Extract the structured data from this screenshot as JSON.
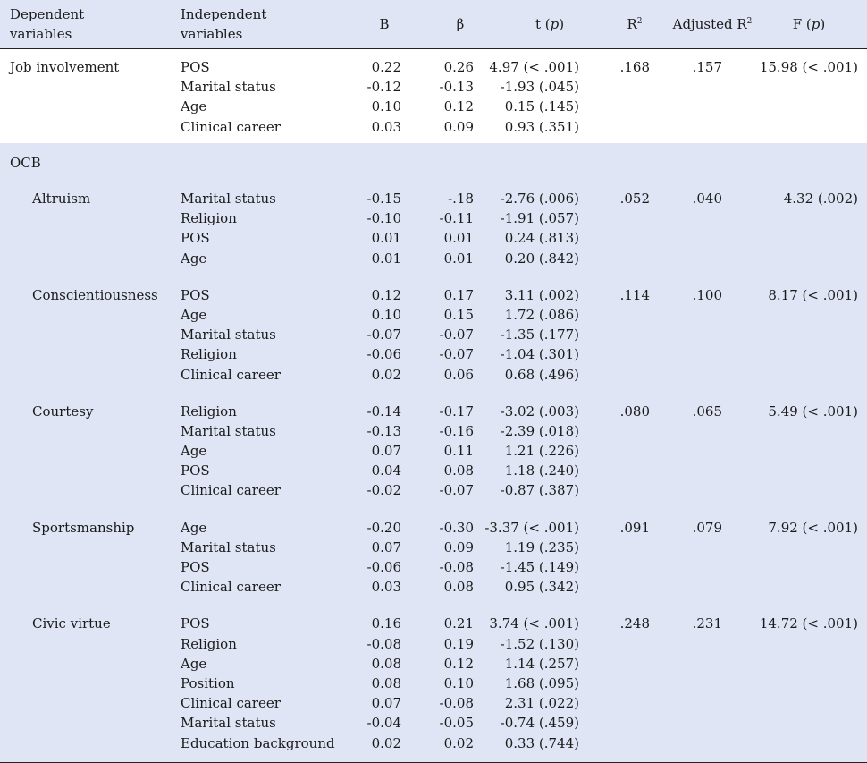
{
  "headers": {
    "dependent": [
      "Dependent",
      "variables"
    ],
    "independent": [
      "Independent",
      "variables"
    ],
    "b": "B",
    "beta": "β",
    "t": "t (",
    "t_p": "p",
    "r2": "R",
    "r2_sup": "2",
    "adj_r2": "Adjusted R",
    "adj_r2_sup": "2",
    "f": "F (",
    "f_p": "p",
    "close_paren": ")"
  },
  "job": {
    "label": "Job involvement",
    "r2": ".168",
    "adj_r2": ".157",
    "f": "15.98 (< .001)",
    "rows": [
      {
        "var": "POS",
        "b": "0.22",
        "beta": "0.26",
        "t": "4.97 (< .001)"
      },
      {
        "var": "Marital status",
        "b": "-0.12",
        "beta": "-0.13",
        "t": "-1.93 (.045)"
      },
      {
        "var": "Age",
        "b": "0.10",
        "beta": "0.12",
        "t": "0.15 (.145)"
      },
      {
        "var": "Clinical career",
        "b": "0.03",
        "beta": "0.09",
        "t": "0.93 (.351)"
      }
    ]
  },
  "ocb": {
    "label": "OCB",
    "altruism": {
      "label": "Altruism",
      "r2": ".052",
      "adj_r2": ".040",
      "f": "4.32 (.002)",
      "rows": [
        {
          "var": "Marital status",
          "b": "-0.15",
          "beta": "-.18",
          "t": "-2.76 (.006)"
        },
        {
          "var": "Religion",
          "b": "-0.10",
          "beta": "-0.11",
          "t": "-1.91 (.057)"
        },
        {
          "var": "POS",
          "b": "0.01",
          "beta": "0.01",
          "t": "0.24 (.813)"
        },
        {
          "var": "Age",
          "b": "0.01",
          "beta": "0.01",
          "t": "0.20 (.842)"
        }
      ]
    },
    "conscientiousness": {
      "label": "Conscientiousness",
      "r2": ".114",
      "adj_r2": ".100",
      "f": "8.17 (< .001)",
      "rows": [
        {
          "var": "POS",
          "b": "0.12",
          "beta": "0.17",
          "t": "3.11 (.002)"
        },
        {
          "var": "Age",
          "b": "0.10",
          "beta": "0.15",
          "t": "1.72 (.086)"
        },
        {
          "var": "Marital status",
          "b": "-0.07",
          "beta": "-0.07",
          "t": "-1.35 (.177)"
        },
        {
          "var": "Religion",
          "b": "-0.06",
          "beta": "-0.07",
          "t": "-1.04 (.301)"
        },
        {
          "var": "Clinical career",
          "b": "0.02",
          "beta": "0.06",
          "t": "0.68 (.496)"
        }
      ]
    },
    "courtesy": {
      "label": "Courtesy",
      "r2": ".080",
      "adj_r2": ".065",
      "f": "5.49 (< .001)",
      "rows": [
        {
          "var": "Religion",
          "b": "-0.14",
          "beta": "-0.17",
          "t": "-3.02 (.003)"
        },
        {
          "var": "Marital status",
          "b": "-0.13",
          "beta": "-0.16",
          "t": "-2.39 (.018)"
        },
        {
          "var": "Age",
          "b": "0.07",
          "beta": "0.11",
          "t": "1.21 (.226)"
        },
        {
          "var": "POS",
          "b": "0.04",
          "beta": "0.08",
          "t": "1.18 (.240)"
        },
        {
          "var": "Clinical career",
          "b": "-0.02",
          "beta": "-0.07",
          "t": "-0.87 (.387)"
        }
      ]
    },
    "sportsmanship": {
      "label": "Sportsmanship",
      "r2": ".091",
      "adj_r2": ".079",
      "f": "7.92 (< .001)",
      "rows": [
        {
          "var": "Age",
          "b": "-0.20",
          "beta": "-0.30",
          "t": "-3.37 (< .001)"
        },
        {
          "var": "Marital status",
          "b": "0.07",
          "beta": "0.09",
          "t": "1.19 (.235)"
        },
        {
          "var": "POS",
          "b": "-0.06",
          "beta": "-0.08",
          "t": "-1.45 (.149)"
        },
        {
          "var": "Clinical career",
          "b": "0.03",
          "beta": "0.08",
          "t": "0.95 (.342)"
        }
      ]
    },
    "civic": {
      "label": "Civic virtue",
      "r2": ".248",
      "adj_r2": ".231",
      "f": "14.72 (< .001)",
      "rows": [
        {
          "var": "POS",
          "b": "0.16",
          "beta": "0.21",
          "t": "3.74 (< .001)"
        },
        {
          "var": "Religion",
          "b": "-0.08",
          "beta": "0.19",
          "t": "-1.52 (.130)"
        },
        {
          "var": "Age",
          "b": "0.08",
          "beta": "0.12",
          "t": "1.14 (.257)"
        },
        {
          "var": "Position",
          "b": "0.08",
          "beta": "0.10",
          "t": "1.68 (.095)"
        },
        {
          "var": "Clinical career",
          "b": "0.07",
          "beta": "-0.08",
          "t": "2.31 (.022)"
        },
        {
          "var": "Marital status",
          "b": "-0.04",
          "beta": "-0.05",
          "t": "-0.74 (.459)"
        },
        {
          "var": "Education background",
          "b": "0.02",
          "beta": "0.02",
          "t": "0.33 (.744)"
        }
      ]
    }
  }
}
